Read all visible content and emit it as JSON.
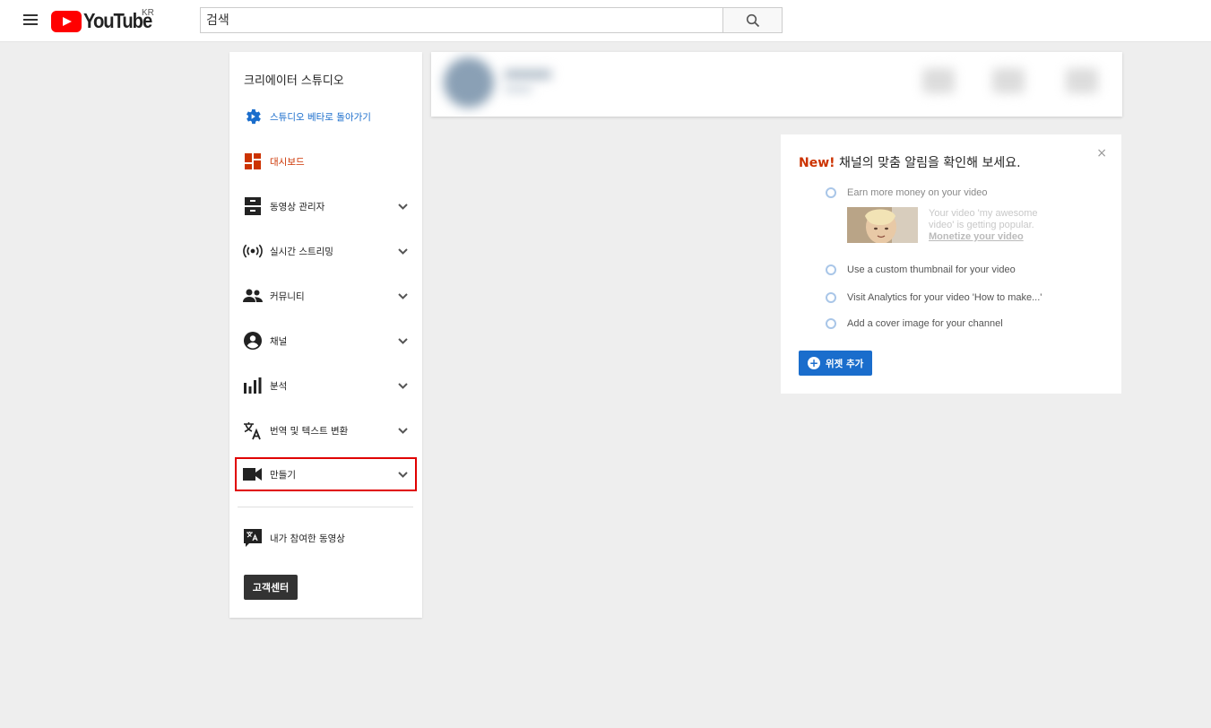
{
  "header": {
    "logo_text": "YouTube",
    "region": "KR",
    "search_placeholder": "검색"
  },
  "sidebar": {
    "title": "크리에이터 스튜디오",
    "items": [
      {
        "label": "스튜디오 베타로 돌아가기",
        "icon": "gear-icon"
      },
      {
        "label": "대시보드",
        "icon": "dashboard-icon"
      },
      {
        "label": "동영상 관리자",
        "icon": "video-manager-icon"
      },
      {
        "label": "실시간 스트리밍",
        "icon": "live-icon"
      },
      {
        "label": "커뮤니티",
        "icon": "people-icon"
      },
      {
        "label": "채널",
        "icon": "account-circle-icon"
      },
      {
        "label": "분석",
        "icon": "bar-chart-icon"
      },
      {
        "label": "번역 및 텍스트 변환",
        "icon": "translate-icon"
      },
      {
        "label": "만들기",
        "icon": "videocam-icon"
      }
    ],
    "contrib_label": "내가 참여한 동영상",
    "help_label": "고객센터"
  },
  "card": {
    "new_label": "New!",
    "title": "채널의 맞춤 알림을 확인해 보세요.",
    "tips": [
      "Earn more money on your video",
      "Use a custom thumbnail for your video",
      "Visit Analytics for your video  'How to make...'",
      "Add a cover image for your channel"
    ],
    "popular_text": "Your video 'my awesome video' is getting popular.",
    "monetize_link": "Monetize your video",
    "add_widget_label": "위젯 추가",
    "close_symbol": "×"
  },
  "colors": {
    "accent_blue": "#1a6dcc",
    "accent_orange": "#cc3300",
    "highlight_red": "#e00000",
    "brand_red": "#ff0000"
  }
}
